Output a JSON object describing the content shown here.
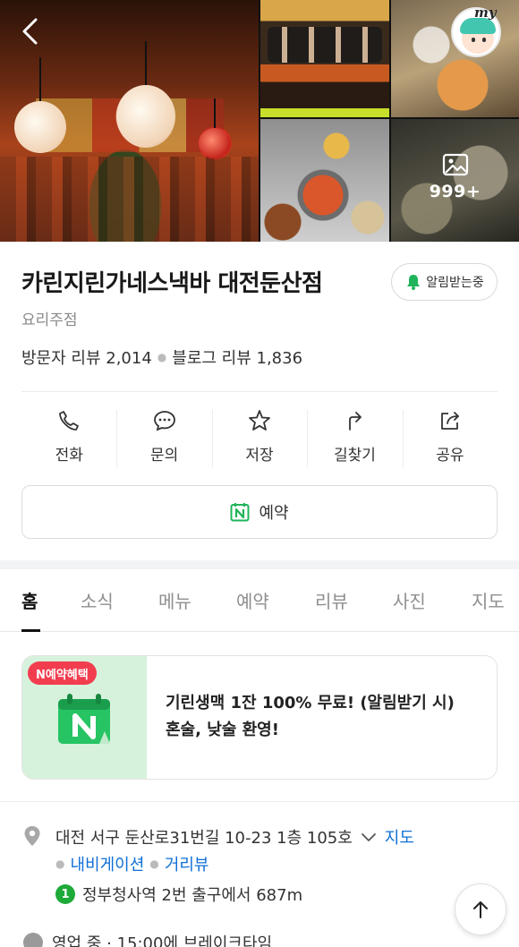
{
  "photos": {
    "more_count": "999+",
    "my_label": "my"
  },
  "place": {
    "name": "카린지린가네스낵바 대전둔산점",
    "category": "요리주점",
    "notify_label": "알림받는중",
    "visitor_reviews": "방문자 리뷰 2,014",
    "blog_reviews": "블로그 리뷰 1,836"
  },
  "actions": [
    {
      "label": "전화",
      "icon": "phone-icon"
    },
    {
      "label": "문의",
      "icon": "chat-icon"
    },
    {
      "label": "저장",
      "icon": "star-icon"
    },
    {
      "label": "길찾기",
      "icon": "directions-icon"
    },
    {
      "label": "공유",
      "icon": "share-icon"
    }
  ],
  "reserve": {
    "label": "예약"
  },
  "tabs": [
    {
      "label": "홈",
      "active": true
    },
    {
      "label": "소식"
    },
    {
      "label": "메뉴"
    },
    {
      "label": "예약"
    },
    {
      "label": "리뷰"
    },
    {
      "label": "사진"
    },
    {
      "label": "지도"
    }
  ],
  "benefit": {
    "badge": "N예약혜택",
    "text": "기린생맥 1잔 100% 무료! (알림받기 시) 혼술, 낮술 환영!"
  },
  "address": {
    "text": "대전 서구 둔산로31번길 10-23 1층 105호",
    "map_link": "지도",
    "navigation": "내비게이션",
    "street_view": "거리뷰",
    "subway_line": "1",
    "subway_text": "정부청사역 2번 출구에서 687m"
  },
  "hours": {
    "text": "영업 중 · 15:00에 브레이크타임"
  },
  "colors": {
    "naver_green": "#1fb45a",
    "link_blue": "#0f6fd6",
    "badge_red": "#f23d4f",
    "subway_line1": "#1eaa39"
  }
}
